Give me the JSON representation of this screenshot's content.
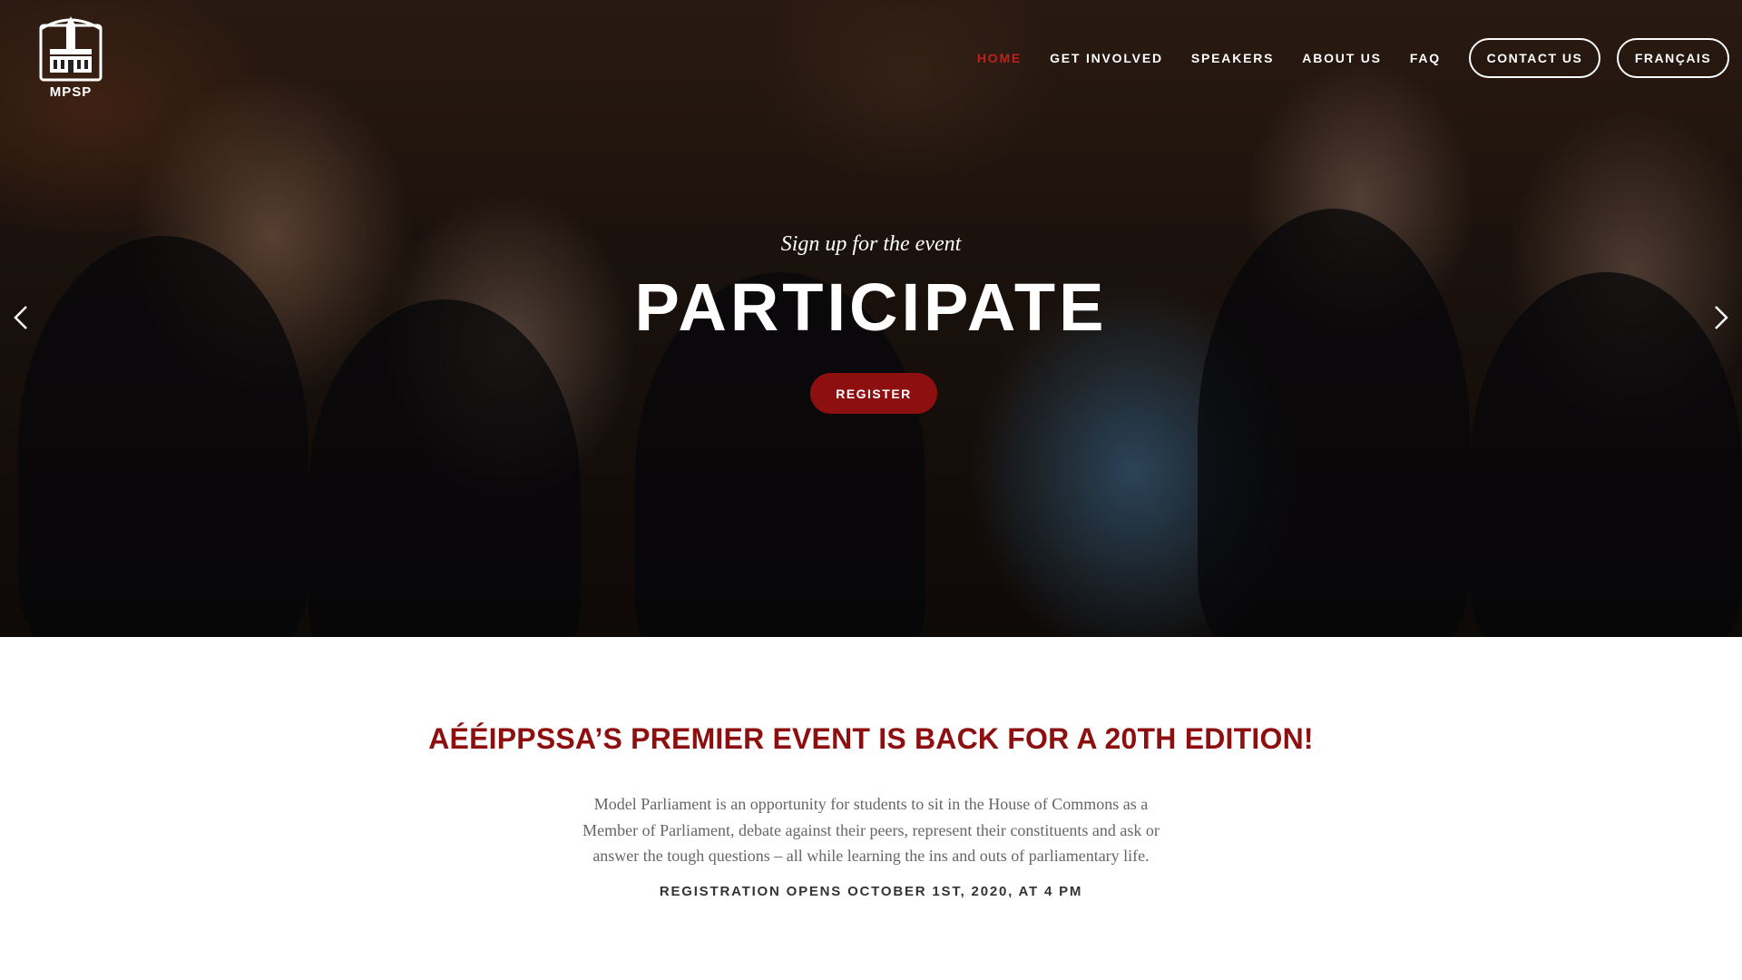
{
  "logo": {
    "text": "MPSP"
  },
  "nav": {
    "links": [
      "HOME",
      "GET INVOLVED",
      "SPEAKERS",
      "ABOUT US",
      "FAQ"
    ],
    "contact_label": "CONTACT US",
    "language_label": "FRANÇAIS",
    "active_index": 0
  },
  "hero": {
    "subtitle": "Sign up for the event",
    "title": "PARTICIPATE",
    "button_label": "REGISTER"
  },
  "section": {
    "title": "AÉÉIPPSSA’S PREMIER EVENT IS BACK FOR A 20TH EDITION!",
    "text": "Model Parliament is an opportunity for students to sit in the House of Commons as a Member of Parliament, debate against their peers, represent their constituents and ask or answer the tough questions – all while learning the ins and outs of parliamentary life.",
    "note": "REGISTRATION OPENS OCTOBER 1ST, 2020, AT 4 PM"
  },
  "colors": {
    "accent": "#8e0f0f",
    "active_nav": "#c0201f",
    "text_gray": "#666666",
    "text_dark": "#333333"
  }
}
